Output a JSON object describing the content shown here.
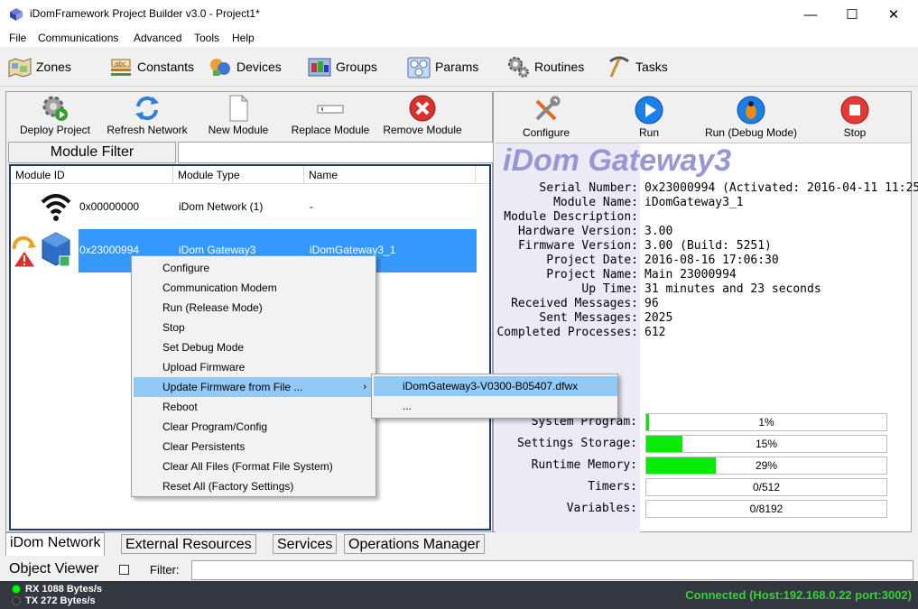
{
  "window": {
    "title": "iDomFramework Project Builder v3.0 - Project1*",
    "minimize": "—",
    "maximize": "☐",
    "close": "✕"
  },
  "menu": [
    "File",
    "Communications",
    "Advanced",
    "Tools",
    "Help"
  ],
  "toolbar": [
    {
      "label": "Zones",
      "icon": "zones-map-icon"
    },
    {
      "label": "Constants",
      "icon": "constants-abc-icon"
    },
    {
      "label": "Devices",
      "icon": "devices-icon"
    },
    {
      "label": "Groups",
      "icon": "groups-icon"
    },
    {
      "label": "Params",
      "icon": "params-icon"
    },
    {
      "label": "Routines",
      "icon": "routines-gears-icon"
    },
    {
      "label": "Tasks",
      "icon": "tasks-pickaxe-icon"
    }
  ],
  "left_panel": {
    "tools": [
      "Deploy Project",
      "Refresh Network",
      "New Module",
      "Replace Module",
      "Remove Module"
    ],
    "filter_label": "Module Filter",
    "filter_value": "",
    "columns": [
      "Module ID",
      "Module Type",
      "Name"
    ],
    "rows": [
      {
        "id": "0x00000000",
        "type": "iDom Network (1)",
        "name": "-",
        "icon": "wifi-icon"
      },
      {
        "id": "0x23000994",
        "type": "iDom Gateway3",
        "name": "iDomGateway3_1",
        "icon": "gateway-cube-icon",
        "selected": true
      }
    ]
  },
  "context_menu": {
    "items": [
      "Configure",
      "Communication Modem",
      "Run (Release Mode)",
      "Stop",
      "Set Debug Mode",
      "Upload Firmware",
      "Update Firmware from File ...",
      "Reboot",
      "Clear Program/Config",
      "Clear Persistents",
      "Clear All Files (Format File System)",
      "Reset All (Factory Settings)"
    ],
    "highlighted_index": 6,
    "submenu_items": [
      "iDomGateway3-V0300-B05407.dfwx",
      "..."
    ],
    "submenu_highlighted_index": 0
  },
  "right_panel": {
    "tools": [
      "Configure",
      "Run",
      "Run (Debug Mode)",
      "Stop"
    ],
    "module_title": "iDom Gateway3",
    "info": [
      {
        "k": "Serial Number:",
        "v": "0x23000994 (Activated: 2016-04-11 11:25:"
      },
      {
        "k": "Module Name:",
        "v": "iDomGateway3_1"
      },
      {
        "k": "Module Description:",
        "v": ""
      },
      {
        "k": "Hardware Version:",
        "v": "3.00"
      },
      {
        "k": "Firmware Version:",
        "v": "3.00 (Build: 5251)"
      },
      {
        "k": "Project Date:",
        "v": "2016-08-16 17:06:30"
      },
      {
        "k": "Project Name:",
        "v": "Main 23000994"
      },
      {
        "k": "Up Time:",
        "v": "31 minutes and 23 seconds"
      },
      {
        "k": "Received Messages:",
        "v": "96"
      },
      {
        "k": "Sent Messages:",
        "v": "2025"
      },
      {
        "k": "Completed Processes:",
        "v": "612"
      }
    ],
    "bars": [
      {
        "k": "System Program:",
        "text": "1%",
        "fraction": 0.01
      },
      {
        "k": "Settings Storage:",
        "text": "15%",
        "fraction": 0.15
      },
      {
        "k": "Runtime Memory:",
        "text": "29%",
        "fraction": 0.29
      },
      {
        "k": "Timers:",
        "text": "0/512",
        "fraction": 0
      },
      {
        "k": "Variables:",
        "text": "0/8192",
        "fraction": 0
      }
    ]
  },
  "tabs": [
    "iDom Network",
    "External Resources",
    "Services",
    "Operations Manager"
  ],
  "active_tab": 0,
  "object_viewer": {
    "label": "Object Viewer",
    "filter_label": "Filter:",
    "filter_value": ""
  },
  "status": {
    "rx": "RX 1088 Bytes/s",
    "tx": "TX 272 Bytes/s",
    "connection": "Connected (Host:192.168.0.22 port:3002)"
  },
  "colors": {
    "selection": "#3399ff",
    "menu_highlight": "#91c9f7",
    "progress": "#06ea06",
    "gateway_title": "#9797d6",
    "connected": "#39d139"
  }
}
